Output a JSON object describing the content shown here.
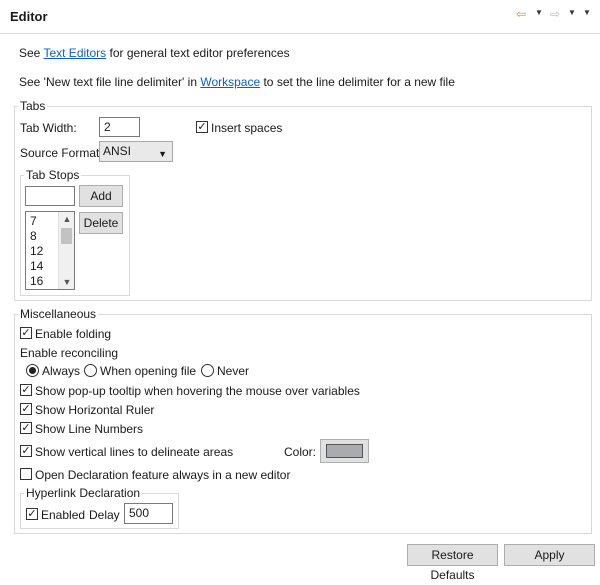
{
  "header": {
    "title": "Editor"
  },
  "intro": {
    "line1_prefix": "See ",
    "line1_link": "Text Editors",
    "line1_suffix": " for general text editor preferences",
    "line2_prefix": "See 'New text file line delimiter' in ",
    "line2_link": "Workspace",
    "line2_suffix": " to set the line delimiter for a new file"
  },
  "tabs": {
    "group_title": "Tabs",
    "tab_width_label": "Tab Width:",
    "tab_width_value": "2",
    "insert_spaces_label": "Insert spaces",
    "insert_spaces_checked": true,
    "source_format_label": "Source Format:",
    "source_format_value": "ANSI",
    "tab_stops": {
      "group_title": "Tab Stops",
      "input_value": "",
      "add_label": "Add",
      "delete_label": "Delete",
      "items": [
        "7",
        "8",
        "12",
        "14",
        "16"
      ]
    }
  },
  "misc": {
    "group_title": "Miscellaneous",
    "enable_folding": "Enable folding",
    "enable_reconciling": "Enable reconciling",
    "reconcile_options": [
      "Always",
      "When opening file",
      "Never"
    ],
    "reconcile_selected": "Always",
    "show_popup_tooltip": "Show pop-up tooltip when hovering the mouse over variables",
    "show_horizontal_ruler": "Show Horizontal Ruler",
    "show_line_numbers": "Show Line Numbers",
    "show_vertical_lines": "Show vertical lines to delineate areas",
    "color_label": "Color:",
    "color_value": "#a9abae",
    "open_declaration": "Open Declaration feature always in a new editor",
    "hyperlink": {
      "group_title": "Hyperlink Declaration",
      "enabled_label": "Enabled",
      "delay_label": "Delay",
      "delay_value": "500"
    }
  },
  "footer": {
    "restore_defaults_label": "Restore Defaults",
    "apply_label": "Apply"
  },
  "check": "✓"
}
